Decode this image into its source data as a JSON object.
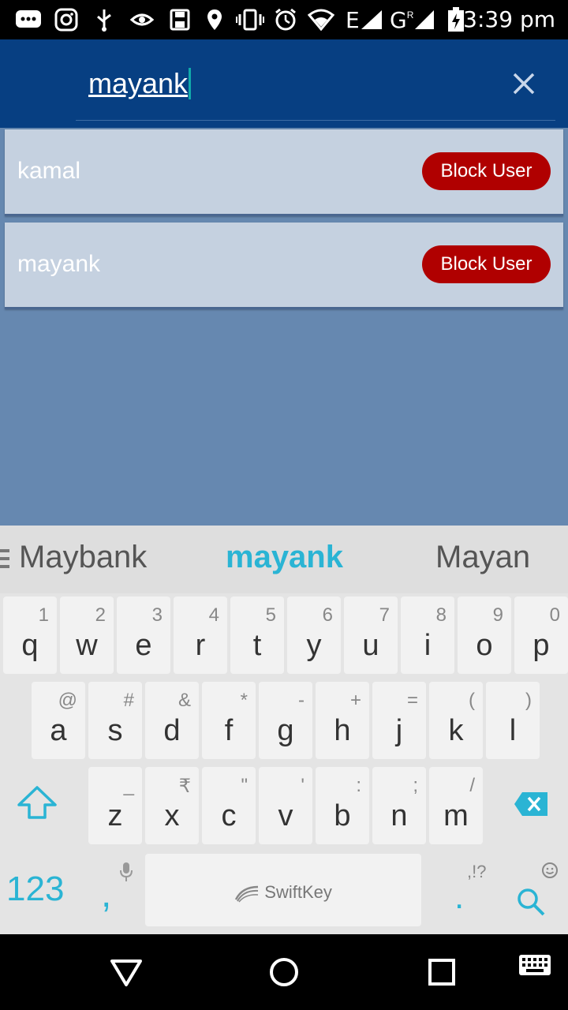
{
  "status_bar": {
    "time": "3:39 pm",
    "network_label": "E",
    "network_label_2": "G",
    "network_sup": "R",
    "icons": [
      "chat-icon",
      "instagram-icon",
      "usb-icon",
      "eye-icon",
      "save-icon",
      "location-icon",
      "vibrate-icon",
      "alarm-icon",
      "wifi-icon",
      "signal-icon",
      "signal-icon",
      "battery-icon"
    ]
  },
  "search": {
    "query": "mayank",
    "clear_icon": "close-icon"
  },
  "results": [
    {
      "name": "kamal",
      "action": "Block User"
    },
    {
      "name": "mayank",
      "action": "Block User"
    }
  ],
  "keyboard": {
    "suggestions": [
      "Maybank",
      "mayank",
      "Mayan"
    ],
    "row1": [
      {
        "key": "q",
        "sub": "1"
      },
      {
        "key": "w",
        "sub": "2"
      },
      {
        "key": "e",
        "sub": "3"
      },
      {
        "key": "r",
        "sub": "4"
      },
      {
        "key": "t",
        "sub": "5"
      },
      {
        "key": "y",
        "sub": "6"
      },
      {
        "key": "u",
        "sub": "7"
      },
      {
        "key": "i",
        "sub": "8"
      },
      {
        "key": "o",
        "sub": "9"
      },
      {
        "key": "p",
        "sub": "0"
      }
    ],
    "row2": [
      {
        "key": "a",
        "sub": "@"
      },
      {
        "key": "s",
        "sub": "#"
      },
      {
        "key": "d",
        "sub": "&"
      },
      {
        "key": "f",
        "sub": "*"
      },
      {
        "key": "g",
        "sub": "-"
      },
      {
        "key": "h",
        "sub": "+"
      },
      {
        "key": "j",
        "sub": "="
      },
      {
        "key": "k",
        "sub": "("
      },
      {
        "key": "l",
        "sub": ")"
      }
    ],
    "row3": [
      {
        "key": "z",
        "sub": "_"
      },
      {
        "key": "x",
        "sub": "₹"
      },
      {
        "key": "c",
        "sub": "\""
      },
      {
        "key": "v",
        "sub": "'"
      },
      {
        "key": "b",
        "sub": ":"
      },
      {
        "key": "n",
        "sub": ";"
      },
      {
        "key": "m",
        "sub": "/"
      }
    ],
    "numbers_label": "123",
    "comma_label": ",",
    "period_label": ".",
    "punct_label": ",!?",
    "spacebar_label": "SwiftKey",
    "accent_color": "#2ab4d4"
  },
  "colors": {
    "app_bar": "#073f82",
    "background": "#6688b0",
    "card": "#c5d1e0",
    "block_button": "#b00000"
  }
}
